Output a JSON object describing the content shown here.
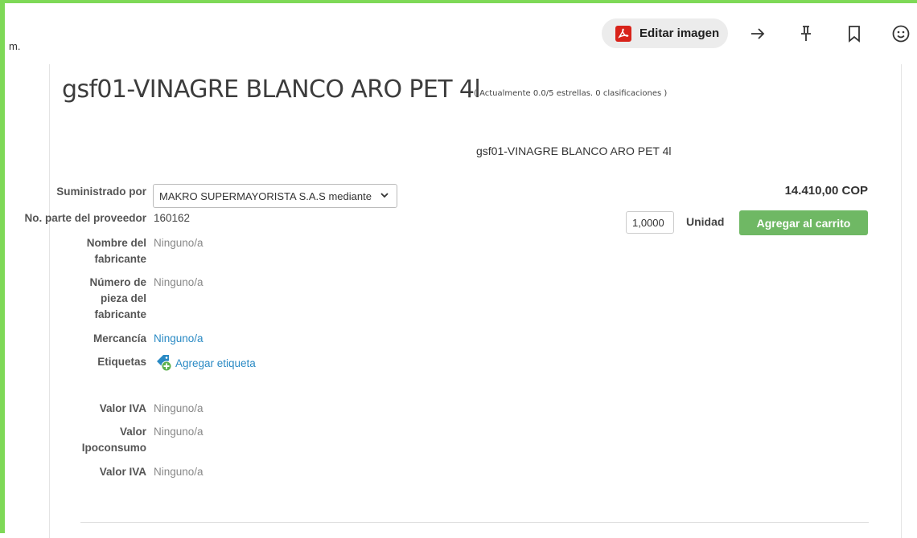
{
  "viewer": {
    "truncated_text": "m.",
    "edit_image_label": "Editar imagen",
    "icons": [
      "pdf-icon",
      "arrow-right-icon",
      "pin-icon",
      "bookmark-icon",
      "smiley-icon"
    ]
  },
  "product": {
    "title": "gsf01-VINAGRE BLANCO ARO PET 4l",
    "rating_text": "( Actualmente 0.0/5 estrellas. 0 clasificaciones )",
    "subtitle": "gsf01-VINAGRE BLANCO ARO PET 4l",
    "price": "14.410,00 COP",
    "quantity": "1,0000",
    "unit": "Unidad",
    "add_to_cart": "Agregar al carrito"
  },
  "details": {
    "supplied_by_label": "Suministrado por",
    "supplied_by_value": "MAKRO SUPERMAYORISTA S.A.S mediante",
    "supplier_part_label": "No. parte del proveedor",
    "supplier_part_value": "160162",
    "manufacturer_name_label": "Nombre del fabricante",
    "manufacturer_name_value": "Ninguno/a",
    "manufacturer_part_label": "Número de pieza del fabricante",
    "manufacturer_part_value": "Ninguno/a",
    "merchandise_label": "Mercancía",
    "merchandise_value": "Ninguno/a",
    "tags_label": "Etiquetas",
    "add_tag": "Agregar etiqueta",
    "iva_label": "Valor IVA",
    "iva_value": "Ninguno/a",
    "ipoconsumo_label": "Valor Ipoconsumo",
    "ipoconsumo_value": "Ninguno/a",
    "iva2_label": "Valor IVA",
    "iva2_value": "Ninguno/a"
  },
  "colors": {
    "frame_border": "#7ed957",
    "cart_button": "#6fb864",
    "link": "#2a8ac4",
    "pdf_red": "#d8231a"
  }
}
